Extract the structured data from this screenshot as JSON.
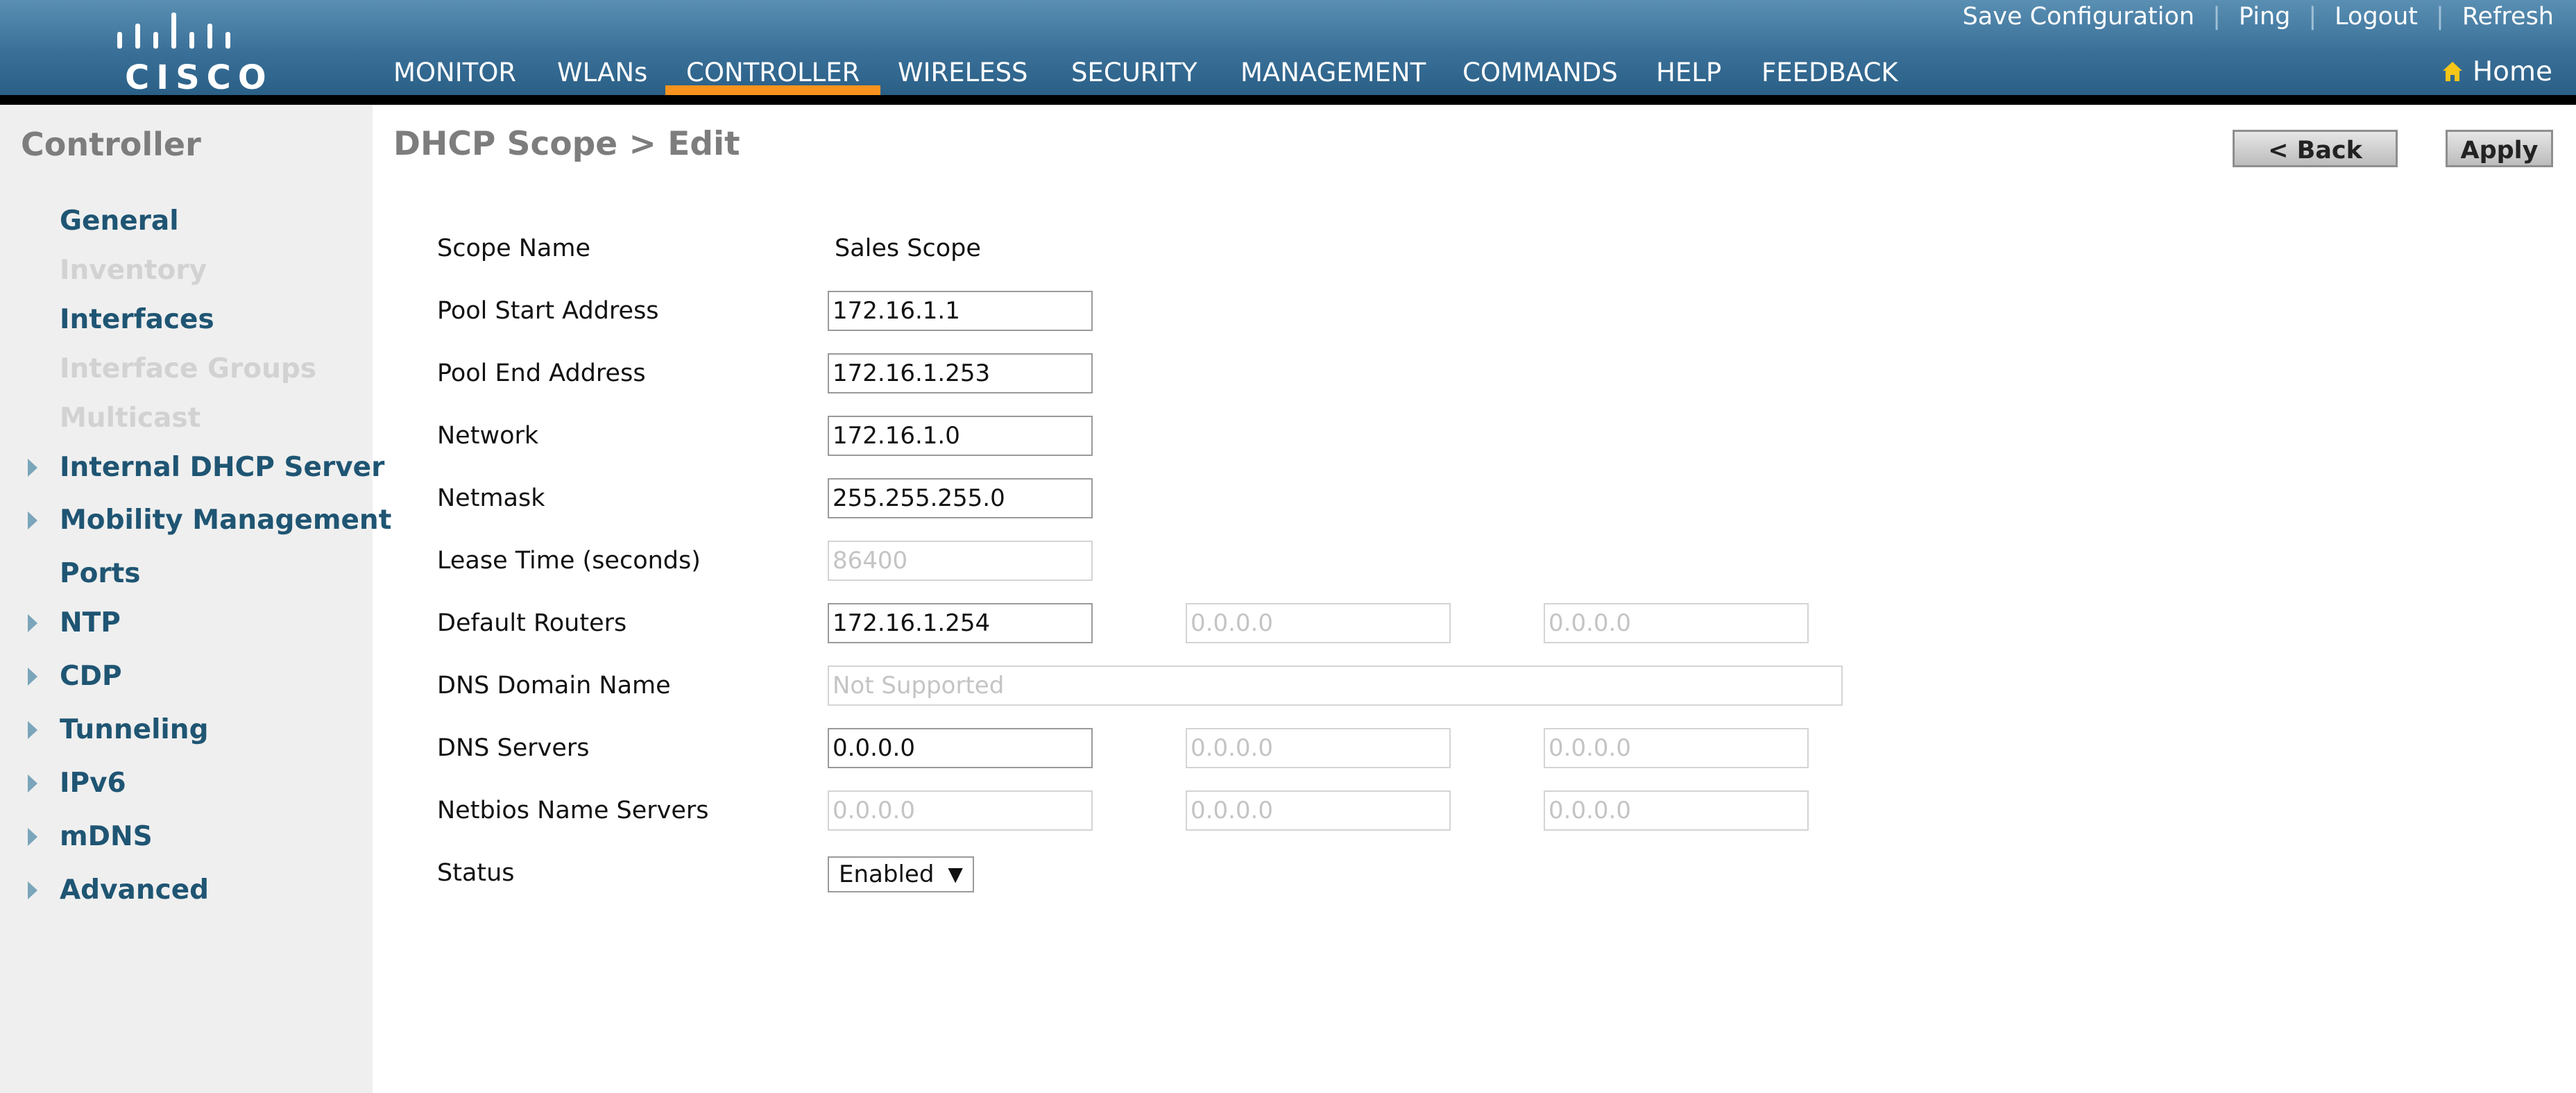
{
  "header": {
    "brand": "CISCO",
    "top_links": [
      "Save Configuration",
      "Ping",
      "Logout",
      "Refresh"
    ],
    "home_label": "Home",
    "nav": [
      "MONITOR",
      "WLANs",
      "CONTROLLER",
      "WIRELESS",
      "SECURITY",
      "MANAGEMENT",
      "COMMANDS",
      "HELP",
      "FEEDBACK"
    ],
    "active_nav": "CONTROLLER"
  },
  "sidebar": {
    "title": "Controller",
    "items": [
      {
        "label": "General",
        "expandable": false,
        "disabled": false
      },
      {
        "label": "Inventory",
        "expandable": false,
        "disabled": true
      },
      {
        "label": "Interfaces",
        "expandable": false,
        "disabled": false
      },
      {
        "label": "Interface Groups",
        "expandable": false,
        "disabled": true
      },
      {
        "label": "Multicast",
        "expandable": false,
        "disabled": true
      },
      {
        "label": "Internal DHCP Server",
        "expandable": true,
        "disabled": false
      },
      {
        "label": "Mobility Management",
        "expandable": true,
        "disabled": false
      },
      {
        "label": "Ports",
        "expandable": false,
        "disabled": false
      },
      {
        "label": "NTP",
        "expandable": true,
        "disabled": false
      },
      {
        "label": "CDP",
        "expandable": true,
        "disabled": false
      },
      {
        "label": "Tunneling",
        "expandable": true,
        "disabled": false
      },
      {
        "label": "IPv6",
        "expandable": true,
        "disabled": false
      },
      {
        "label": "mDNS",
        "expandable": true,
        "disabled": false
      },
      {
        "label": "Advanced",
        "expandable": true,
        "disabled": false
      }
    ]
  },
  "page": {
    "title": "DHCP Scope > Edit",
    "back_label": "< Back",
    "apply_label": "Apply"
  },
  "form": {
    "scope_name": {
      "label": "Scope Name",
      "value": "Sales Scope"
    },
    "pool_start": {
      "label": "Pool Start Address",
      "value": "172.16.1.1"
    },
    "pool_end": {
      "label": "Pool End Address",
      "value": "172.16.1.253"
    },
    "network": {
      "label": "Network",
      "value": "172.16.1.0"
    },
    "netmask": {
      "label": "Netmask",
      "value": "255.255.255.0"
    },
    "lease_time": {
      "label": "Lease Time (seconds)",
      "placeholder": "86400"
    },
    "default_routers": {
      "label": "Default Routers",
      "value1": "172.16.1.254",
      "placeholder2": "0.0.0.0",
      "placeholder3": "0.0.0.0"
    },
    "dns_domain": {
      "label": "DNS Domain Name",
      "placeholder": "Not Supported"
    },
    "dns_servers": {
      "label": "DNS Servers",
      "value1": "0.0.0.0",
      "placeholder2": "0.0.0.0",
      "placeholder3": "0.0.0.0"
    },
    "netbios": {
      "label": "Netbios Name Servers",
      "placeholder1": "0.0.0.0",
      "placeholder2": "0.0.0.0",
      "placeholder3": "0.0.0.0"
    },
    "status": {
      "label": "Status",
      "value": "Enabled"
    }
  },
  "colors": {
    "header_blue": "#3a7098",
    "active_tab_orange": "#f7931e",
    "sidebar_link": "#1f5573",
    "home_icon": "#f5c518"
  }
}
